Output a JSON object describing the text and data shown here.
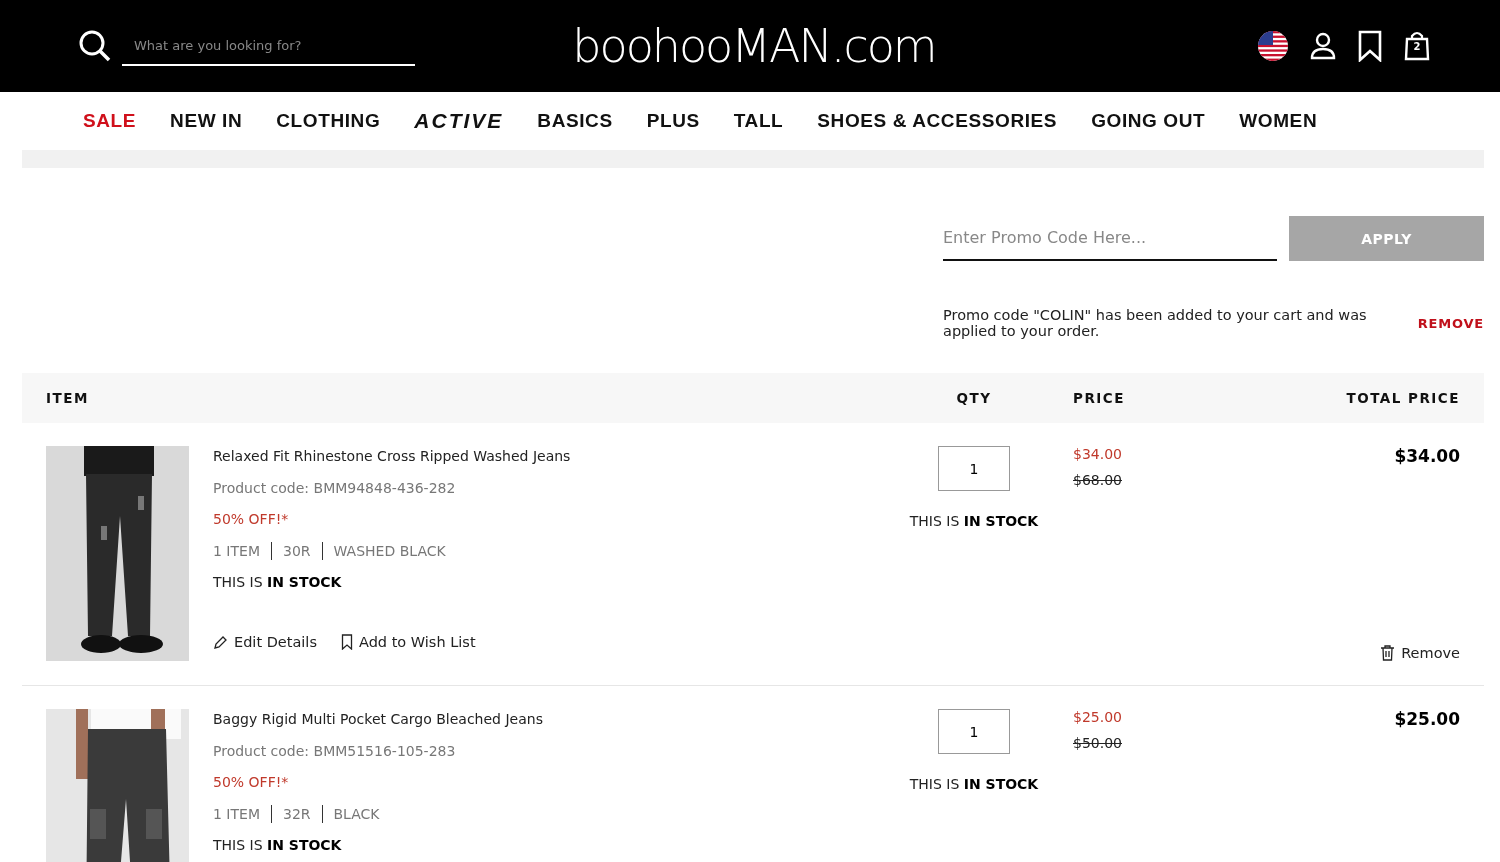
{
  "header": {
    "search": {
      "placeholder": "What are you looking for?"
    },
    "logo": "boohooMAN.com",
    "bag_count": "2"
  },
  "nav": [
    {
      "label": "SALE",
      "kind": "sale"
    },
    {
      "label": "NEW IN",
      "kind": "plain"
    },
    {
      "label": "CLOTHING",
      "kind": "plain"
    },
    {
      "label": "ACTIVE",
      "kind": "active"
    },
    {
      "label": "BASICS",
      "kind": "plain"
    },
    {
      "label": "PLUS",
      "kind": "plain"
    },
    {
      "label": "TALL",
      "kind": "plain"
    },
    {
      "label": "SHOES & ACCESSORIES",
      "kind": "plain"
    },
    {
      "label": "GOING OUT",
      "kind": "plain"
    },
    {
      "label": "WOMEN",
      "kind": "plain"
    }
  ],
  "promo": {
    "placeholder": "Enter Promo Code Here...",
    "button": "APPLY",
    "message": "Promo code \"COLIN\" has been added to your cart and was applied to your order.",
    "remove": "REMOVE"
  },
  "table": {
    "columns": [
      "ITEM",
      "QTY",
      "PRICE",
      "TOTAL PRICE"
    ],
    "rows": [
      {
        "name": "Relaxed Fit Rhinestone Cross Ripped Washed Jeans",
        "code": "Product code: BMM94848-436-282",
        "discount": "50% OFF!*",
        "attributes": [
          "1 ITEM",
          "30R",
          "WASHED BLACK"
        ],
        "stock": "THIS IS **IN STOCK**",
        "qty": "1",
        "qty_stock": "THIS IS **IN STOCK**",
        "price": "$34.00",
        "was": "$68.00",
        "total": "$34.00",
        "actions": [
          "Edit Details",
          "Add to Wish List"
        ],
        "remove": "Remove"
      },
      {
        "name": "Baggy Rigid Multi Pocket Cargo Bleached Jeans",
        "code": "Product code: BMM51516-105-283",
        "discount": "50% OFF!*",
        "attributes": [
          "1 ITEM",
          "32R",
          "BLACK"
        ],
        "stock": "THIS IS **IN STOCK**",
        "qty": "1",
        "qty_stock": "THIS IS **IN STOCK**",
        "price": "$25.00",
        "was": "$50.00",
        "total": "$25.00"
      }
    ]
  }
}
